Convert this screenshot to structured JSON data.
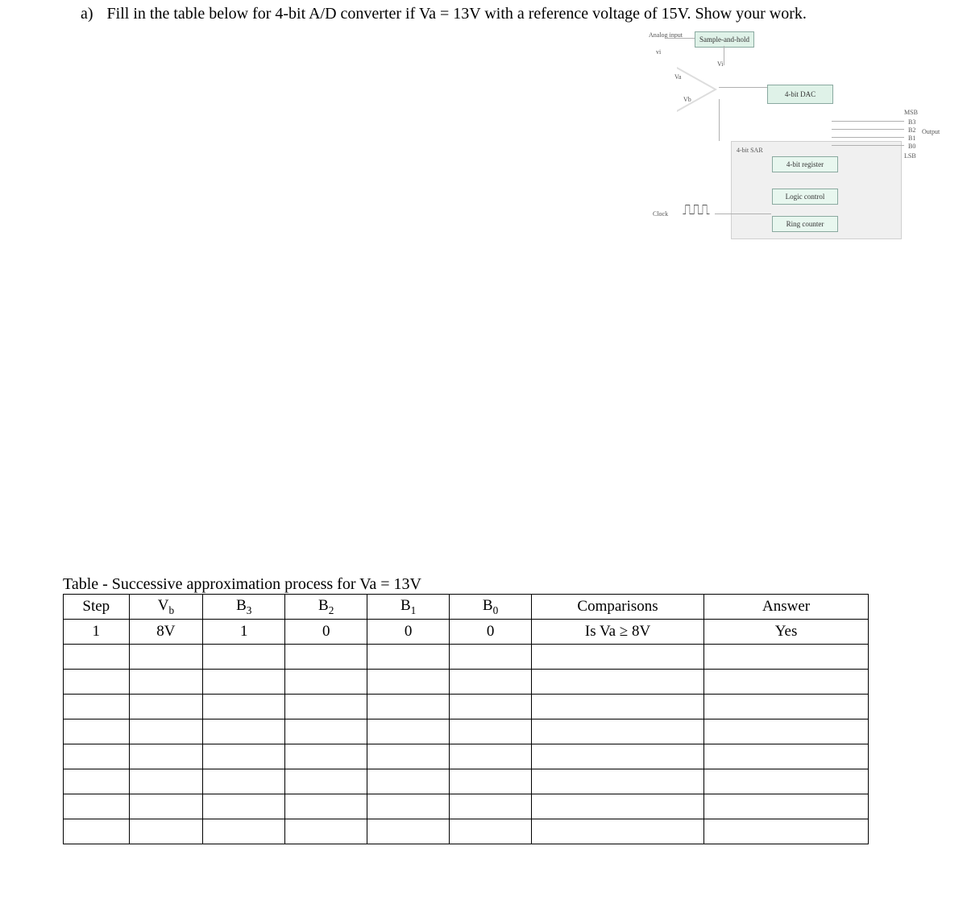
{
  "question": {
    "marker": "a)",
    "text": "Fill in the table below for 4-bit A/D converter if Va = 13V with a reference voltage of 15V. Show your work."
  },
  "diagram": {
    "analog_input_label": "Analog\ninput",
    "analog_input_symbol": "vi",
    "sample_hold": "Sample-and-hold",
    "comparator_top": "Vi",
    "comparator_in_a": "Va",
    "comparator_in_b": "Vb",
    "dac": "4-bit DAC",
    "sar_label": "4-bit SAR",
    "register": "4-bit register",
    "logic": "Logic control",
    "ring": "Ring counter",
    "output": "Output",
    "msb": "MSB",
    "lsb": "LSB",
    "bits": [
      "B3",
      "B2",
      "B1",
      "B0"
    ],
    "clock": "Clock"
  },
  "table": {
    "caption": "Table - Successive approximation process for Va = 13V",
    "headers": {
      "step": "Step",
      "vb": "V",
      "vb_sub": "b",
      "b3": "B",
      "b3_sub": "3",
      "b2": "B",
      "b2_sub": "2",
      "b1": "B",
      "b1_sub": "1",
      "b0": "B",
      "b0_sub": "0",
      "comp": "Comparisons",
      "ans": "Answer"
    },
    "rows": [
      {
        "step": "1",
        "vb": "8V",
        "b3": "1",
        "b2": "0",
        "b1": "0",
        "b0": "0",
        "comp": "Is Va ≥ 8V",
        "ans": "Yes"
      },
      {
        "step": "",
        "vb": "",
        "b3": "",
        "b2": "",
        "b1": "",
        "b0": "",
        "comp": "",
        "ans": ""
      },
      {
        "step": "",
        "vb": "",
        "b3": "",
        "b2": "",
        "b1": "",
        "b0": "",
        "comp": "",
        "ans": ""
      },
      {
        "step": "",
        "vb": "",
        "b3": "",
        "b2": "",
        "b1": "",
        "b0": "",
        "comp": "",
        "ans": ""
      },
      {
        "step": "",
        "vb": "",
        "b3": "",
        "b2": "",
        "b1": "",
        "b0": "",
        "comp": "",
        "ans": ""
      },
      {
        "step": "",
        "vb": "",
        "b3": "",
        "b2": "",
        "b1": "",
        "b0": "",
        "comp": "",
        "ans": ""
      },
      {
        "step": "",
        "vb": "",
        "b3": "",
        "b2": "",
        "b1": "",
        "b0": "",
        "comp": "",
        "ans": ""
      },
      {
        "step": "",
        "vb": "",
        "b3": "",
        "b2": "",
        "b1": "",
        "b0": "",
        "comp": "",
        "ans": ""
      },
      {
        "step": "",
        "vb": "",
        "b3": "",
        "b2": "",
        "b1": "",
        "b0": "",
        "comp": "",
        "ans": ""
      }
    ]
  }
}
